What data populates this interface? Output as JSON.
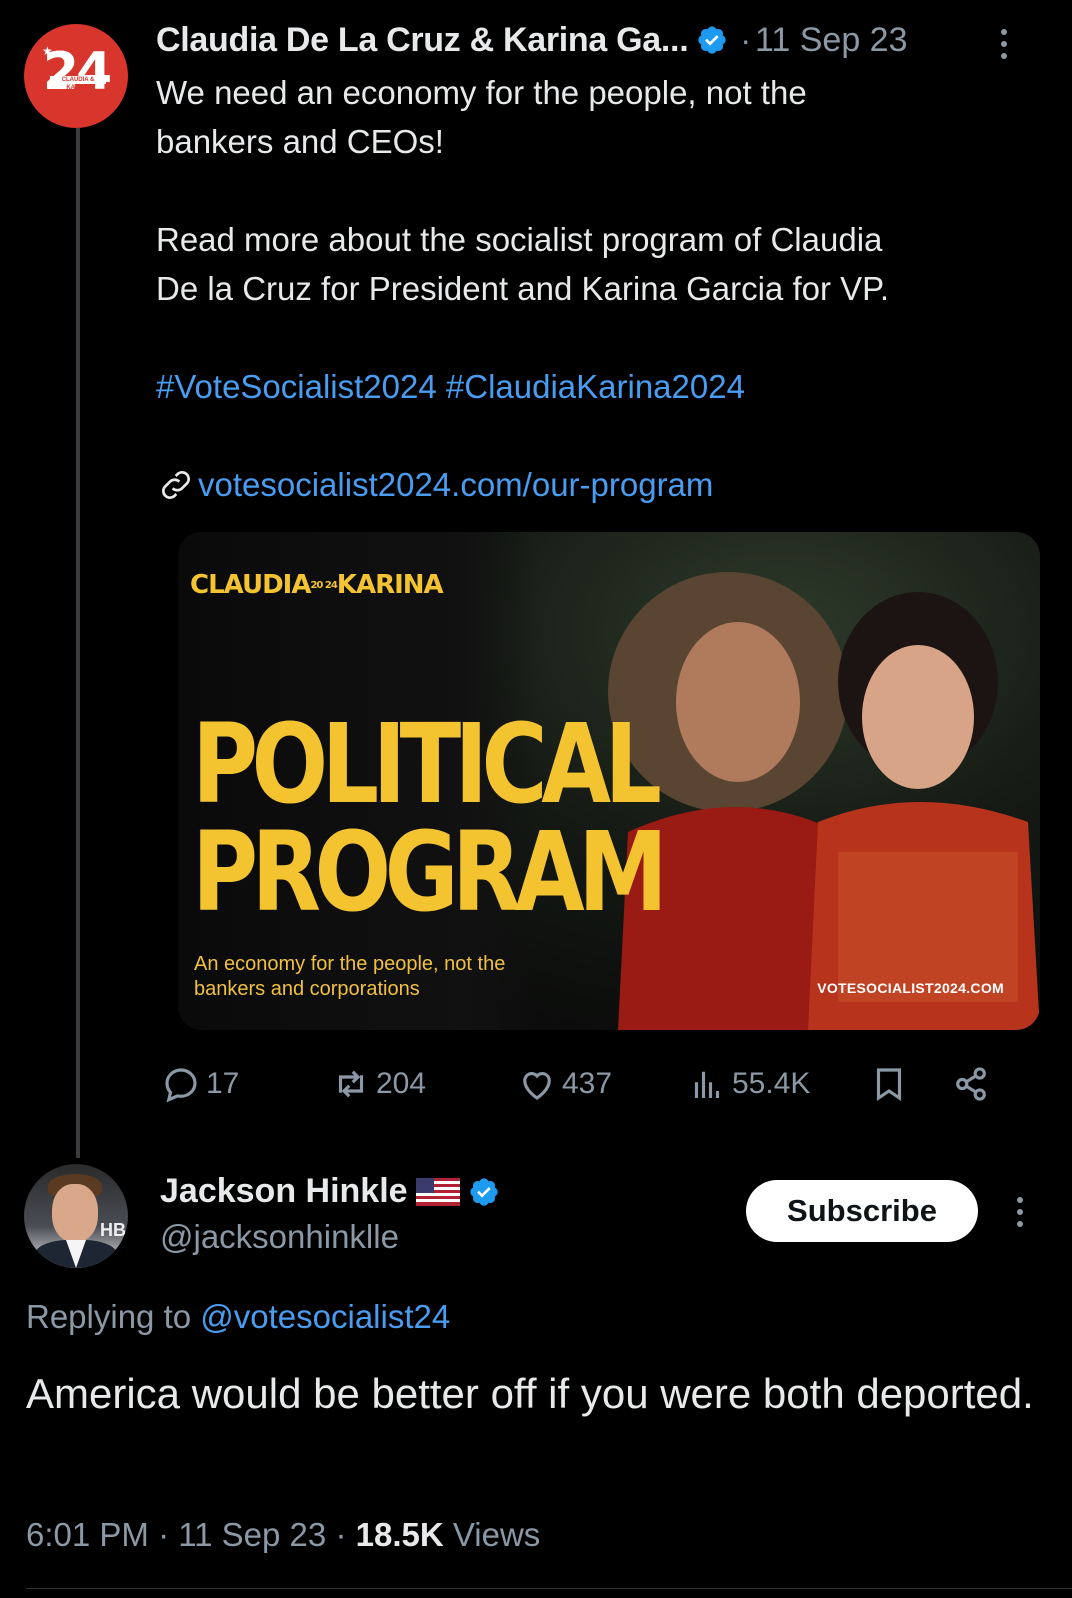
{
  "tweet1": {
    "avatar_text": "24",
    "avatar_sub": "CLAUDIA & KARINA",
    "display_name": "Claudia De La Cruz & Karina Ga...",
    "separator": "·",
    "date": "11 Sep 23",
    "body_line1": "We need an economy for the people, not the\nbankers and CEOs!",
    "body_line2": "Read more about the socialist program of Claudia\nDe la Cruz for President and Karina Garcia for VP.",
    "hashtags": "#VoteSocialist2024 #ClaudiaKarina2024",
    "link": "votesocialist2024.com/our-program",
    "card": {
      "brand_left": "CLAUDIA",
      "brand_mid": "20 24",
      "brand_right": "KARINA",
      "headline_1": "POLITICAL",
      "headline_2": "PROGRAM",
      "tagline": "An economy for the people, not the bankers and corporations",
      "url": "VOTESOCIALIST2024.COM"
    },
    "actions": {
      "replies": "17",
      "reposts": "204",
      "likes": "437",
      "views": "55.4K"
    }
  },
  "tweet2": {
    "avatar_text": "HB",
    "display_name": "Jackson Hinkle",
    "handle": "@jacksonhinklle",
    "subscribe_label": "Subscribe",
    "replying_prefix": "Replying to ",
    "replying_handle": "@votesocialist24",
    "body": "America would be better off if you were both deported.",
    "time": "6:01 PM",
    "separator": "·",
    "date": "11 Sep 23",
    "views_count": "18.5K",
    "views_label": "Views"
  },
  "colors": {
    "background": "#000000",
    "text": "#e7e9ea",
    "muted": "#8b98a5",
    "link": "#4a9cf0",
    "verified": "#1d9bf0",
    "accent_yellow": "#f4c430",
    "avatar_red": "#d8352c"
  },
  "icons": [
    "verified-badge-icon",
    "more-icon",
    "link-icon",
    "reply-icon",
    "repost-icon",
    "like-icon",
    "views-icon",
    "bookmark-icon",
    "share-icon",
    "us-flag-icon"
  ]
}
